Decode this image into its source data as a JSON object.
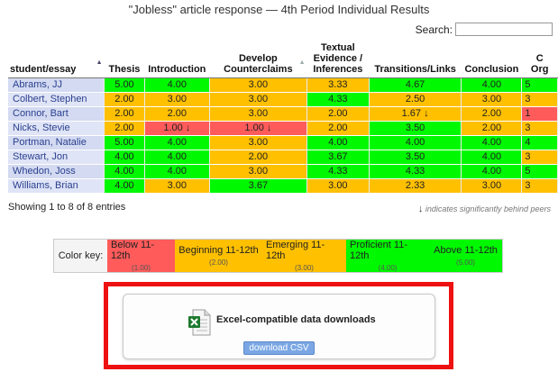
{
  "title": "\"Jobless\" article response — 4th Period Individual Results",
  "search": {
    "label": "Search:",
    "value": ""
  },
  "table": {
    "columns": [
      {
        "label": "student/essay",
        "sort": "asc"
      },
      {
        "label": "Thesis"
      },
      {
        "label": "Introduction"
      },
      {
        "label": "Develop\nCounterclaims"
      },
      {
        "label": "Textual\nEvidence /\nInferences"
      },
      {
        "label": "Transitions/Links"
      },
      {
        "label": "Conclusion"
      },
      {
        "label": "C\nOrg"
      }
    ],
    "rows": [
      {
        "student": "Abrams, JJ",
        "cells": [
          {
            "v": "5.00",
            "c": "green"
          },
          {
            "v": "4.00",
            "c": "green"
          },
          {
            "v": "3.00",
            "c": "yellow"
          },
          {
            "v": "3.33",
            "c": "yellow"
          },
          {
            "v": "4.67",
            "c": "green"
          },
          {
            "v": "4.00",
            "c": "green"
          },
          {
            "v": "5",
            "c": "green"
          }
        ]
      },
      {
        "student": "Colbert, Stephen",
        "cells": [
          {
            "v": "2.00",
            "c": "yellow"
          },
          {
            "v": "3.00",
            "c": "yellow"
          },
          {
            "v": "3.00",
            "c": "yellow"
          },
          {
            "v": "4.33",
            "c": "green"
          },
          {
            "v": "2.50",
            "c": "yellow"
          },
          {
            "v": "3.00",
            "c": "yellow"
          },
          {
            "v": "3",
            "c": "yellow"
          }
        ]
      },
      {
        "student": "Connor, Bart",
        "cells": [
          {
            "v": "2.00",
            "c": "yellow"
          },
          {
            "v": "2.00",
            "c": "yellow"
          },
          {
            "v": "3.00",
            "c": "yellow"
          },
          {
            "v": "2.00",
            "c": "yellow"
          },
          {
            "v": "1.67 ↓",
            "c": "yellow"
          },
          {
            "v": "2.00",
            "c": "yellow"
          },
          {
            "v": "1",
            "c": "red"
          }
        ]
      },
      {
        "student": "Nicks, Stevie",
        "cells": [
          {
            "v": "2.00",
            "c": "yellow"
          },
          {
            "v": "1.00 ↓",
            "c": "red"
          },
          {
            "v": "1.00 ↓",
            "c": "red"
          },
          {
            "v": "2.00",
            "c": "yellow"
          },
          {
            "v": "3.50",
            "c": "green"
          },
          {
            "v": "2.00",
            "c": "yellow"
          },
          {
            "v": "3",
            "c": "yellow"
          }
        ]
      },
      {
        "student": "Portman, Natalie",
        "cells": [
          {
            "v": "5.00",
            "c": "green"
          },
          {
            "v": "4.00",
            "c": "green"
          },
          {
            "v": "3.00",
            "c": "yellow"
          },
          {
            "v": "4.00",
            "c": "green"
          },
          {
            "v": "4.00",
            "c": "green"
          },
          {
            "v": "4.00",
            "c": "green"
          },
          {
            "v": "4",
            "c": "green"
          }
        ]
      },
      {
        "student": "Stewart, Jon",
        "cells": [
          {
            "v": "4.00",
            "c": "green"
          },
          {
            "v": "4.00",
            "c": "green"
          },
          {
            "v": "2.00",
            "c": "yellow"
          },
          {
            "v": "3.67",
            "c": "green"
          },
          {
            "v": "3.50",
            "c": "green"
          },
          {
            "v": "4.00",
            "c": "green"
          },
          {
            "v": "3",
            "c": "yellow"
          }
        ]
      },
      {
        "student": "Whedon, Joss",
        "cells": [
          {
            "v": "4.00",
            "c": "green"
          },
          {
            "v": "4.00",
            "c": "green"
          },
          {
            "v": "3.00",
            "c": "yellow"
          },
          {
            "v": "4.33",
            "c": "green"
          },
          {
            "v": "4.33",
            "c": "green"
          },
          {
            "v": "4.00",
            "c": "green"
          },
          {
            "v": "5",
            "c": "green"
          }
        ]
      },
      {
        "student": "Williams, Brian",
        "cells": [
          {
            "v": "4.00",
            "c": "green"
          },
          {
            "v": "3.00",
            "c": "yellow"
          },
          {
            "v": "3.67",
            "c": "green"
          },
          {
            "v": "3.00",
            "c": "yellow"
          },
          {
            "v": "2.33",
            "c": "yellow"
          },
          {
            "v": "3.00",
            "c": "yellow"
          },
          {
            "v": "3",
            "c": "yellow"
          }
        ]
      }
    ]
  },
  "showing": "Showing 1 to 8 of 8 entries",
  "behind_note": {
    "arrow": "↓",
    "text": "indicates significantly behind peers"
  },
  "color_key": {
    "label": "Color key:",
    "items": [
      {
        "label": "Below 11-12th",
        "value": "(1.00)",
        "color": "#ff5b5b"
      },
      {
        "label": "Beginning 11-12th",
        "value": "(2.00)",
        "color": "#ffc000"
      },
      {
        "label": "Emerging 11-12th",
        "value": "(3.00)",
        "color": "#ffc000"
      },
      {
        "label": "Proficient 11-12th",
        "value": "(4.00)",
        "color": "#00f800"
      },
      {
        "label": "Above 11-12th",
        "value": "(5.00)",
        "color": "#00f800"
      }
    ]
  },
  "downloads": {
    "title": "Excel-compatible data downloads",
    "button": "download CSV",
    "icon": "excel-file-icon"
  },
  "colors": {
    "green": "#00f800",
    "yellow": "#ffc000",
    "red": "#ff5b5b",
    "highlight": "#ee1111"
  }
}
